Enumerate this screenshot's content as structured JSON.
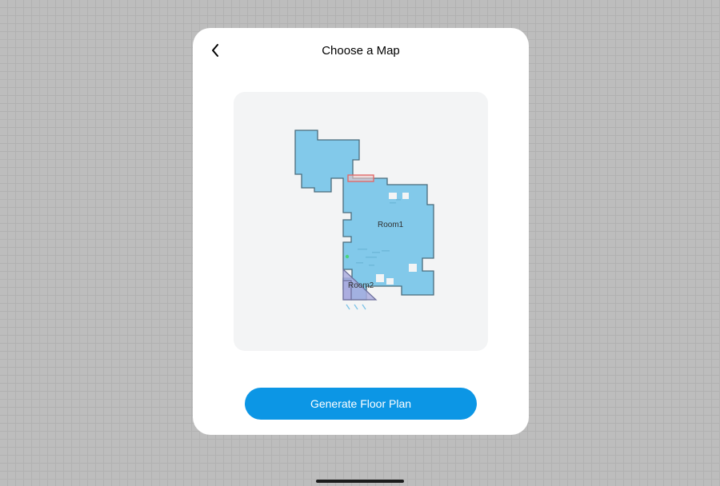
{
  "header": {
    "title": "Choose a Map",
    "back_icon": "chevron-left"
  },
  "map": {
    "rooms": [
      {
        "id": "room1",
        "label": "Room1"
      },
      {
        "id": "room2",
        "label": "Room2"
      }
    ],
    "colors": {
      "room1_fill": "#82c9ea",
      "room1_stroke": "#4a6b7b",
      "room2_fill": "#a9acdf",
      "room2_stroke": "#6b6e9a",
      "dock_stroke": "#e06a6a",
      "dock_fill": "#ecc7c7",
      "speckle": "#6fb9da"
    }
  },
  "actions": {
    "generate_label": "Generate Floor Plan"
  }
}
